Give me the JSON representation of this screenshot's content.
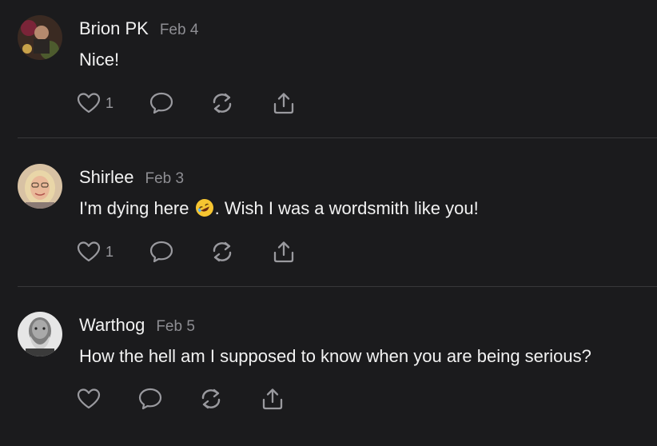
{
  "comments": [
    {
      "author": "Brion PK",
      "date": "Feb 4",
      "text": "Nice!",
      "likes": "1"
    },
    {
      "author": "Shirlee",
      "date": "Feb 3",
      "text_before": "I'm dying here",
      "text_after": ". Wish I was a wordsmith like you!",
      "emoji": "rolling-on-floor-laughing",
      "likes": "1"
    },
    {
      "author": "Warthog",
      "date": "Feb 5",
      "text": "How the hell am I supposed to know when you are being serious?",
      "likes": ""
    }
  ],
  "icons": {
    "like": "heart-icon",
    "reply": "comment-bubble-icon",
    "restack": "restack-icon",
    "share": "share-icon"
  },
  "colors": {
    "background": "#1b1b1d",
    "text": "#f2f2f2",
    "muted": "#8e8e93",
    "divider": "#38383a"
  }
}
